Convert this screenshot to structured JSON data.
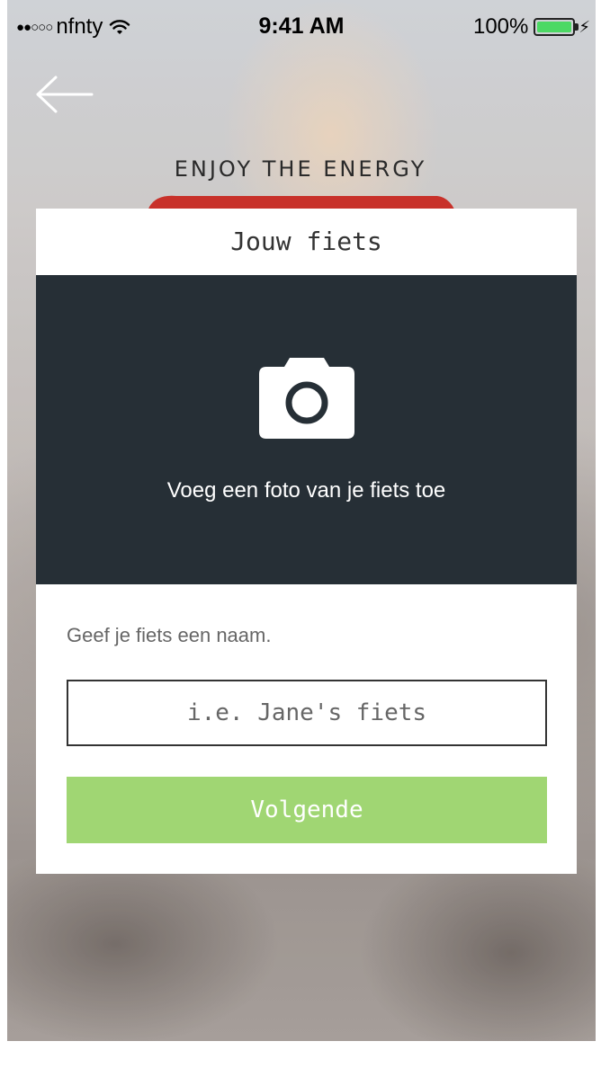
{
  "status_bar": {
    "signal": "●●○○○",
    "carrier": "nfnty",
    "time": "9:41 AM",
    "battery_percent": "100%",
    "battery_level": 1.0,
    "charge_glyph": "⚡"
  },
  "background": {
    "tagline": "ENJOY THE ENERGY",
    "brand_logo_color": "#c8312a"
  },
  "modal": {
    "title": "Jouw fiets",
    "photo_area_label": "Voeg een foto van je fiets toe",
    "name_label": "Geef je fiets een naam.",
    "name_input": {
      "value": "",
      "placeholder": "i.e. Jane's fiets"
    },
    "next_button_label": "Volgende"
  },
  "icons": {
    "back": "arrow-left-icon",
    "camera": "camera-icon",
    "wifi": "wifi-icon",
    "battery": "battery-icon"
  },
  "colors": {
    "photo_area_bg": "#262f36",
    "primary_button": "#a0d673",
    "battery_fill": "#4cd964"
  }
}
